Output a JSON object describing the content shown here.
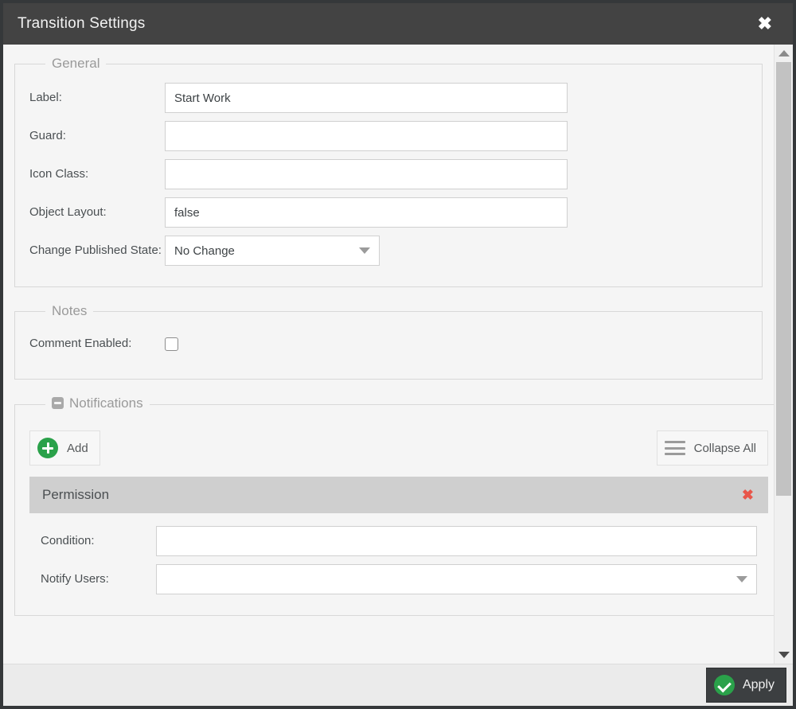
{
  "window": {
    "title": "Transition Settings",
    "close_icon": "close-icon"
  },
  "general": {
    "legend": "General",
    "fields": [
      {
        "label": "Label:",
        "value": "Start Work",
        "type": "text"
      },
      {
        "label": "Guard:",
        "value": "",
        "type": "text"
      },
      {
        "label": "Icon Class:",
        "value": "",
        "type": "text"
      },
      {
        "label": "Object Layout:",
        "value": "false",
        "type": "text"
      }
    ],
    "published_state": {
      "label": "Change Published State:",
      "value": "No Change",
      "caret_icon": "chevron-down-icon"
    }
  },
  "notes": {
    "legend": "Notes",
    "comment_enabled": {
      "label": "Comment Enabled:",
      "checked": false
    }
  },
  "notifications": {
    "legend": "Notifications",
    "collapse_toggle_icon": "minus-box-icon",
    "toolbar": {
      "add_label": "Add",
      "add_icon": "plus-circle-icon",
      "collapse_all_label": "Collapse All",
      "collapse_all_icon": "hamburger-icon"
    },
    "items": [
      {
        "title": "Permission",
        "delete_icon": "close-icon",
        "fields": [
          {
            "label": "Condition:",
            "value": "",
            "type": "text"
          },
          {
            "label": "Notify Users:",
            "value": "",
            "type": "select",
            "caret_icon": "chevron-down-icon"
          }
        ]
      }
    ]
  },
  "scrollbar": {
    "up_icon": "caret-up-icon",
    "down_icon": "caret-down-icon"
  },
  "footer": {
    "apply_label": "Apply",
    "apply_icon": "check-circle-icon"
  },
  "colors": {
    "titlebar": "#434343",
    "accent_green": "#2aa14a",
    "delete_red": "#e8564a",
    "panel_bg": "#f5f5f5",
    "notif_header": "#cfcfcf"
  }
}
